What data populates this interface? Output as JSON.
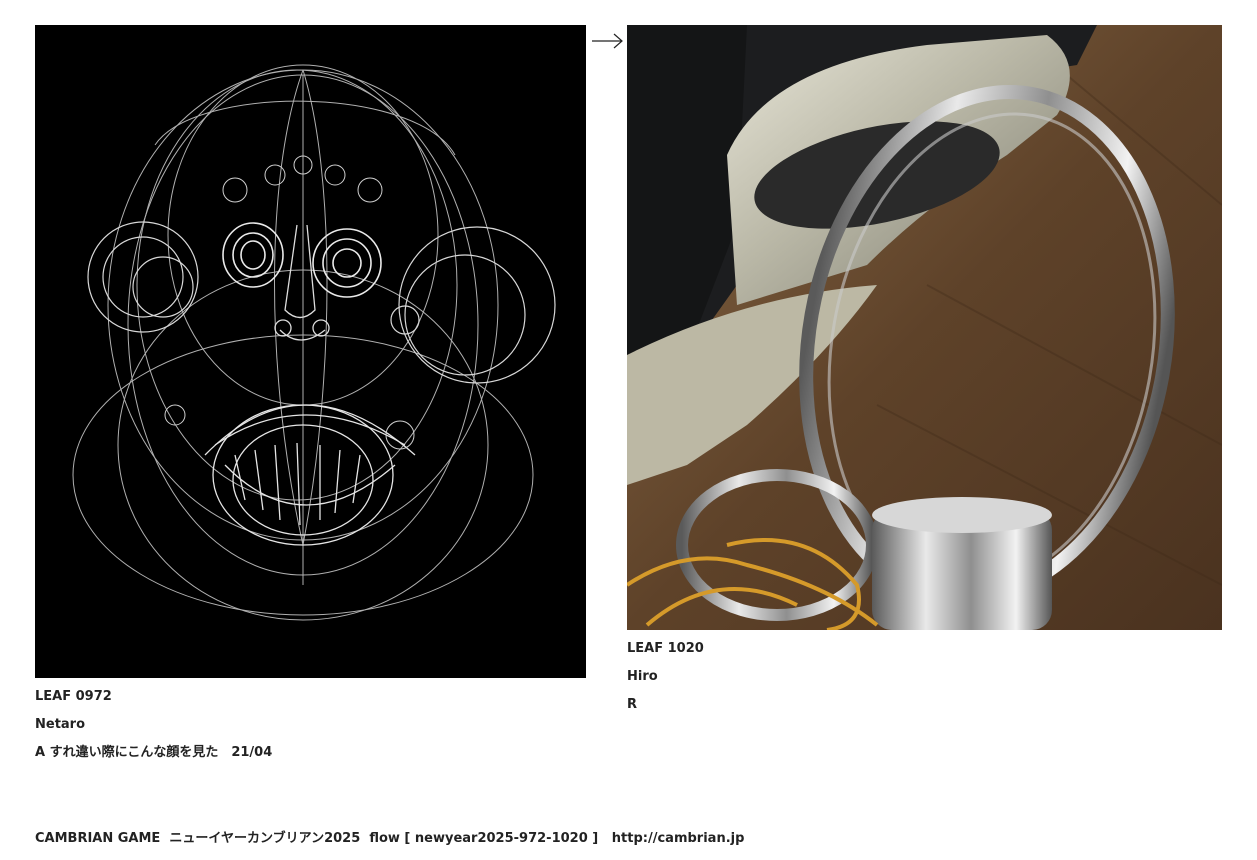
{
  "left_leaf": {
    "id": "LEAF 0972",
    "author": "Netaro",
    "caption": "A すれ違い際にこんな顔を見た　21/04"
  },
  "right_leaf": {
    "id": "LEAF 1020",
    "author": "Hiro",
    "caption": "R"
  },
  "flow_arrow": "→",
  "footer": {
    "site_name": "CAMBRIAN GAME",
    "title": "ニューイヤーカンブリアン2025",
    "flow": "flow [ newyear2025-972-1020 ]",
    "url": "http://cambrian.jp"
  }
}
